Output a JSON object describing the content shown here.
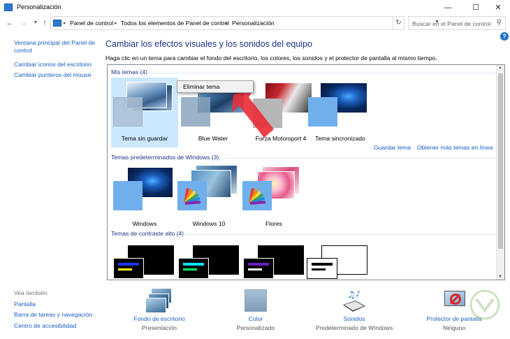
{
  "window": {
    "title": "Personalización"
  },
  "address": {
    "crumbs": [
      "Panel de control",
      "Todos los elementos de Panel de control",
      "Personalización"
    ],
    "search_placeholder": "Buscar en el Panel de control"
  },
  "left_pane": {
    "links": [
      "Ventana principal del Panel de control",
      "Cambiar iconos del escritorio",
      "Cambiar punteros del mouse"
    ],
    "see_also_label": "Vea también",
    "see_also": [
      "Pantalla",
      "Barra de tareas y navegación",
      "Centro de accesibilidad"
    ]
  },
  "main": {
    "heading": "Cambiar los efectos visuales y los sonidos del equipo",
    "subtext": "Haga clic en un tema para cambiar el fondo del escritorio, los colores, los sonidos y el protector de pantalla al mismo tiempo.",
    "groups": [
      {
        "label": "Mis temas (4)",
        "themes": [
          "Tema sin guardar",
          "Blue Water",
          "Forza Motorsport 4",
          "Tema sincronizado"
        ],
        "links": [
          "Guardar tema",
          "Obtener más temas en línea"
        ]
      },
      {
        "label": "Temas predeterminados de Windows (3)",
        "themes": [
          "Windows",
          "Windows 10",
          "Flores"
        ]
      },
      {
        "label": "Temas de contraste alto (4)",
        "themes": []
      }
    ],
    "context_menu": {
      "item": "Eliminar tema"
    }
  },
  "bottom": [
    {
      "title": "Fondo de escritorio",
      "value": "Presentación",
      "icon": "desktop-background-icon"
    },
    {
      "title": "Color",
      "value": "Personalizado",
      "icon": "color-icon"
    },
    {
      "title": "Sonidos",
      "value": "Predeterminado de Windows",
      "icon": "sounds-icon"
    },
    {
      "title": "Protector de pantalla",
      "value": "Ninguno",
      "icon": "screensaver-icon"
    }
  ],
  "colors": {
    "link": "#1a5ec4",
    "heading": "#1e3287",
    "selected": "#cce8ff",
    "arrow": "#e8313a"
  }
}
